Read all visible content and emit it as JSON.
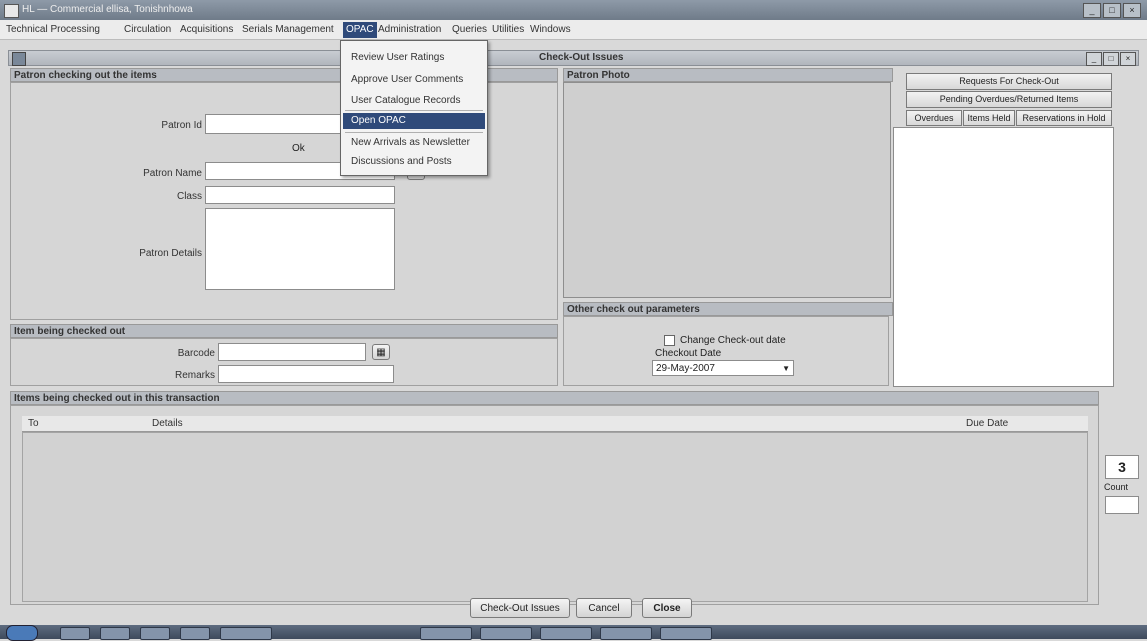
{
  "window": {
    "title": "HL — Commercial ellisa, Tonishnhowa"
  },
  "menu": {
    "items": [
      "Technical Processing",
      "Circulation",
      "Acquisitions",
      "Serials Management",
      "OPAC",
      "Administration",
      "Queries",
      "Utilities",
      "Windows"
    ]
  },
  "opac_menu": {
    "items": [
      "Review User Ratings",
      "Approve User Comments",
      "User Catalogue Records",
      "Open OPAC",
      "New Arrivals as Newsletter",
      "Discussions and Posts"
    ]
  },
  "child_window": {
    "title": "Check-Out Issues"
  },
  "patron_section": {
    "header": "Patron checking out the items",
    "patron_id_label": "Patron Id",
    "patron_id_value": "",
    "ok_label": "Ok",
    "patron_name_label": "Patron Name",
    "patron_name_value": "",
    "class_label": "Class",
    "class_value": "",
    "patron_details_label": "Patron Details"
  },
  "photo_section": {
    "header": "Patron Photo"
  },
  "right_panel": {
    "requests_button": "Requests For Check-Out",
    "pending_button": "Pending Overdues/Returned Items",
    "tabs": [
      "Overdues",
      "Items Held",
      "Reservations in Hold"
    ]
  },
  "items_checkout": {
    "header": "Item being checked out",
    "barcode_label": "Barcode",
    "barcode_value": "",
    "remarks_label": "Remarks",
    "remarks_value": ""
  },
  "other_params": {
    "header": "Other check out parameters",
    "change_date_label": "Change Check-out date",
    "checkout_date_label": "Checkout Date",
    "checkout_date_value": "29-May-2007"
  },
  "items_grid": {
    "header": "Items being checked out in this transaction",
    "columns": [
      "To",
      "Details",
      "Due Date"
    ]
  },
  "side_counter": {
    "value": "3",
    "label": "Count"
  },
  "footer_buttons": {
    "checkout": "Check-Out Issues",
    "cancel": "Cancel",
    "close": "Close"
  }
}
